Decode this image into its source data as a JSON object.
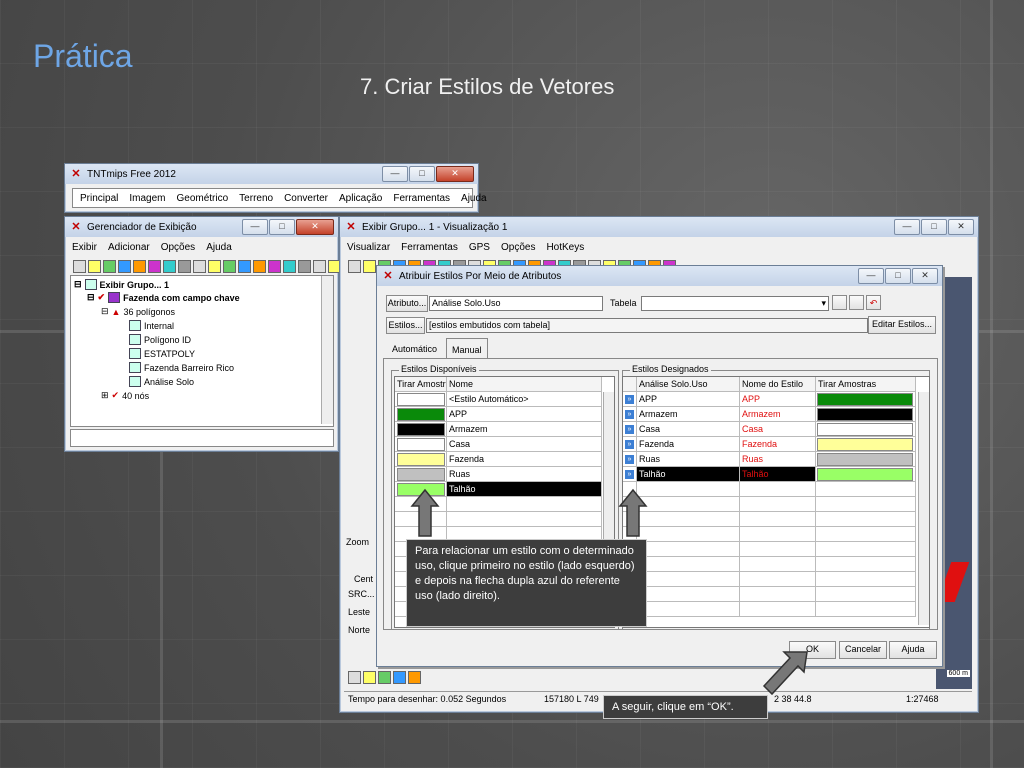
{
  "slide": {
    "title": "Prática",
    "subtitle": "7. Criar Estilos de Vetores"
  },
  "tnt": {
    "title": "TNTmips Free 2012",
    "menu": [
      "Principal",
      "Imagem",
      "Geométrico",
      "Terreno",
      "Converter",
      "Aplicação",
      "Ferramentas",
      "Ajuda"
    ]
  },
  "manager": {
    "title": "Gerenciador de Exibição",
    "menu": [
      "Exibir",
      "Adicionar",
      "Opções",
      "Ajuda"
    ],
    "tree": {
      "group": "Exibir Grupo... 1",
      "layer": "Fazenda com campo chave",
      "polygons": "36 polígonos",
      "items": [
        "Internal",
        "Polígono ID",
        "ESTATPOLY",
        "Fazenda Barreiro Rico",
        "Análise Solo"
      ],
      "nodes": "40 nós"
    }
  },
  "view": {
    "title": "Exibir Grupo... 1 - Visualização 1",
    "menu": [
      "Visualizar",
      "Ferramentas",
      "GPS",
      "Opções",
      "HotKeys"
    ],
    "side": {
      "zoom": "Zoom",
      "cent": "Cent",
      "src": "SRC...",
      "leste": "Leste",
      "norte": "Norte"
    },
    "status": {
      "draw_time": "Tempo para desenhar: 0.052 Segundos",
      "coords": "157180 L  749",
      "coords2": "2 38 44.8",
      "scale": "1:27468",
      "scalebar": "600 m"
    }
  },
  "dialog": {
    "title": "Atribuir Estilos Por Meio de Atributos",
    "atributo_label": "Atributo...",
    "atributo_value": "Análise Solo.Uso",
    "tabela_label": "Tabela",
    "estilos_label": "Estilos...",
    "estilos_value": "[estilos embutidos com tabela]",
    "editar_label": "Editar Estilos...",
    "tabs": [
      "Automático",
      "Manual"
    ],
    "disponiveis": {
      "legend": "Estilos Disponíveis",
      "headers": [
        "Tirar Amostr",
        "Nome"
      ],
      "rows": [
        {
          "name": "<Estilo Automático>",
          "color": "#ffffff"
        },
        {
          "name": "APP",
          "color": "#0a8a0a"
        },
        {
          "name": "Armazem",
          "color": "#000000"
        },
        {
          "name": "Casa",
          "color": "#ffffff"
        },
        {
          "name": "Fazenda",
          "color": "#ffff99"
        },
        {
          "name": "Ruas",
          "color": "#c0c0c0"
        },
        {
          "name": "Talhão",
          "color": "#99ff66"
        }
      ]
    },
    "designados": {
      "legend": "Estilos Designados",
      "headers": [
        "Análise Solo.Uso",
        "Nome do Estilo",
        "Tirar Amostras"
      ],
      "rows": [
        {
          "uso": "APP",
          "estilo": "APP",
          "color": "#0a8a0a"
        },
        {
          "uso": "Armazem",
          "estilo": "Armazem",
          "color": "#000000"
        },
        {
          "uso": "Casa",
          "estilo": "Casa",
          "color": "#ffffff"
        },
        {
          "uso": "Fazenda",
          "estilo": "Fazenda",
          "color": "#ffff99"
        },
        {
          "uso": "Ruas",
          "estilo": "Ruas",
          "color": "#c0c0c0"
        },
        {
          "uso": "Talhão",
          "estilo": "Talhão",
          "color": "#99ff66"
        }
      ]
    },
    "ok": "OK",
    "cancel": "Cancelar",
    "help": "Ajuda"
  },
  "callouts": {
    "main": "Para relacionar um estilo com o determinado uso, clique primeiro no estilo (lado esquerdo) e depois na flecha dupla azul do referente uso (lado direito).",
    "ok": "A seguir, clique em “OK”."
  }
}
